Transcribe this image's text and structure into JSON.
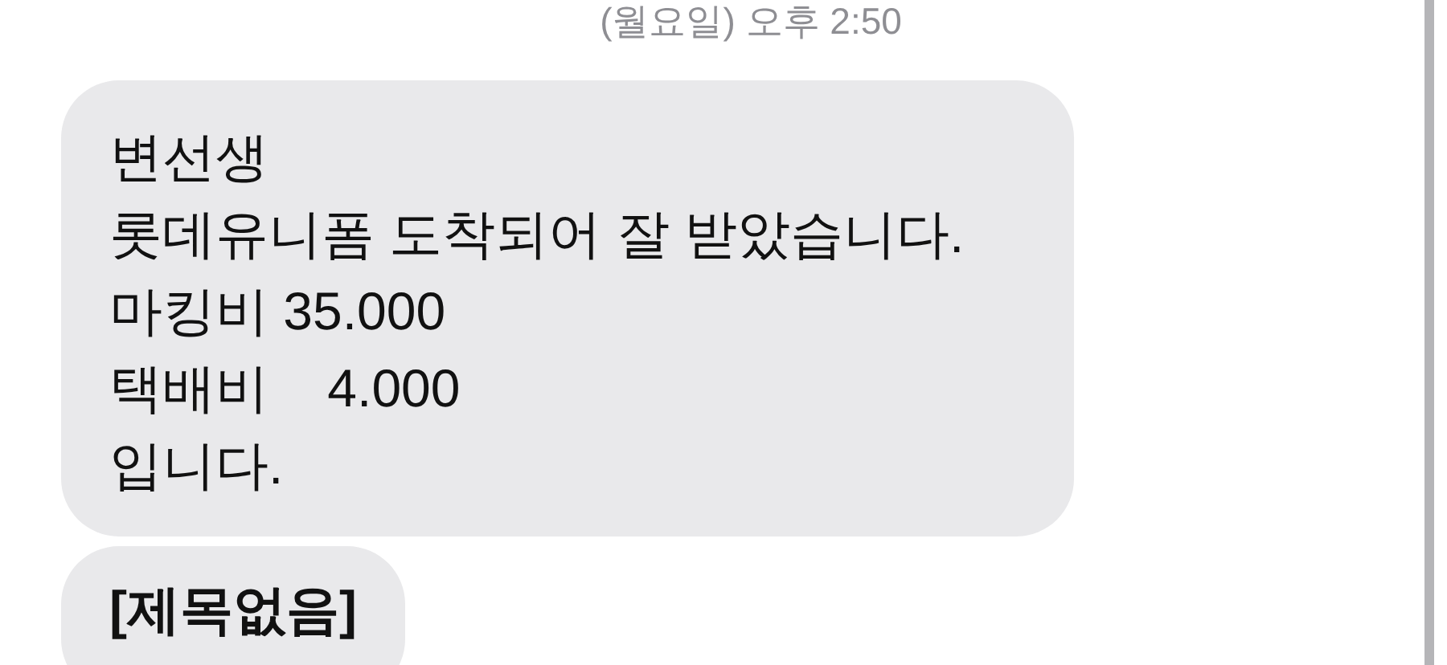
{
  "timestamp": "(월요일) 오후 2:50",
  "messages": [
    {
      "kind": "text",
      "text": "변선생\n롯데유니폼 도착되어 잘 받았습니다.\n마킹비 35.000\n택배비    4.000\n입니다."
    },
    {
      "kind": "subject",
      "text": "[제목없음]"
    }
  ]
}
